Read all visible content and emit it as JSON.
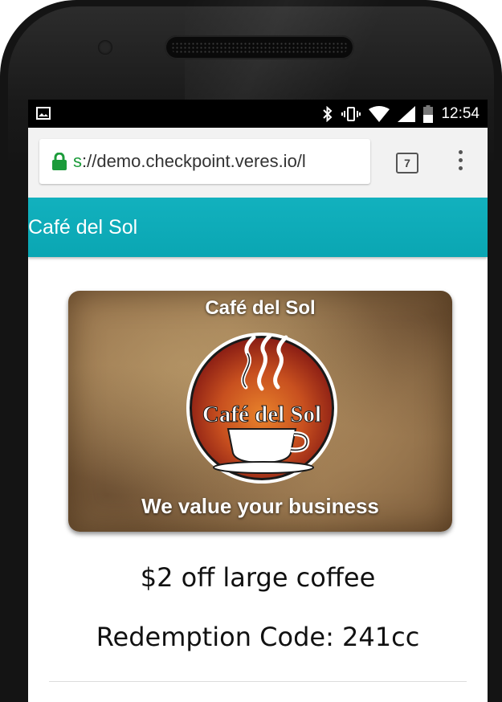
{
  "status_bar": {
    "time": "12:54",
    "icons": [
      "image-notification-icon",
      "bluetooth-icon",
      "vibrate-icon",
      "wifi-icon",
      "cell-signal-icon",
      "battery-icon"
    ]
  },
  "browser": {
    "url_scheme": "s",
    "url_rest": "://demo.checkpoint.veres.io/l",
    "tab_count": "7",
    "secure": true,
    "secure_color": "#1b9b3a"
  },
  "app_bar": {
    "title": "Café del Sol",
    "color": "#0aa6b3"
  },
  "card": {
    "top_text": "Café del Sol",
    "logo_text": "Café del Sol",
    "bottom_text": "We value your business"
  },
  "offer": {
    "description": "$2 off large coffee",
    "code_text": "Redemption Code: 241cc"
  }
}
